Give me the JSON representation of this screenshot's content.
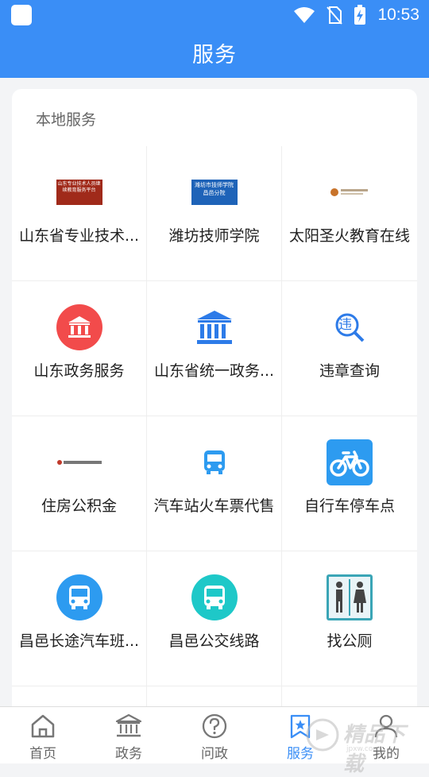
{
  "status_bar": {
    "time": "10:53"
  },
  "app_bar": {
    "title": "服务"
  },
  "section": {
    "title": "本地服务"
  },
  "grid": [
    {
      "label": "山东省专业技术...",
      "icon": "continuing-education-logo-icon",
      "logo_text": "山东专业技术人员继续教育服务平台"
    },
    {
      "label": "潍坊技师学院",
      "icon": "weifang-technician-college-logo-icon",
      "logo_text": "潍坊市技师学院 昌邑分院"
    },
    {
      "label": "太阳圣火教育在线",
      "icon": "sun-fire-education-logo-icon",
      "logo_text": ""
    },
    {
      "label": "山东政务服务",
      "icon": "government-building-red-icon"
    },
    {
      "label": "山东省统一政务...",
      "icon": "government-building-blue-icon"
    },
    {
      "label": "违章查询",
      "icon": "violation-search-icon",
      "glyph": "违"
    },
    {
      "label": "住房公积金",
      "icon": "housing-fund-logo-icon",
      "logo_text": ""
    },
    {
      "label": "汽车站火车票代售",
      "icon": "bus-ticket-icon"
    },
    {
      "label": "自行车停车点",
      "icon": "bicycle-icon"
    },
    {
      "label": "昌邑长途汽车班...",
      "icon": "long-distance-bus-icon"
    },
    {
      "label": "昌邑公交线路",
      "icon": "city-bus-icon"
    },
    {
      "label": "找公厕",
      "icon": "restroom-icon"
    }
  ],
  "bottom_nav": [
    {
      "label": "首页",
      "icon": "home-icon"
    },
    {
      "label": "政务",
      "icon": "government-icon"
    },
    {
      "label": "问政",
      "icon": "question-icon"
    },
    {
      "label": "服务",
      "icon": "service-star-icon",
      "active": true
    },
    {
      "label": "我的",
      "icon": "profile-icon"
    }
  ],
  "watermark": {
    "text": "精品下载",
    "sub": "jpxw.com"
  },
  "colors": {
    "primary": "#3a8ef6",
    "red": "#f24b4b",
    "teal": "#1ec8c8"
  }
}
